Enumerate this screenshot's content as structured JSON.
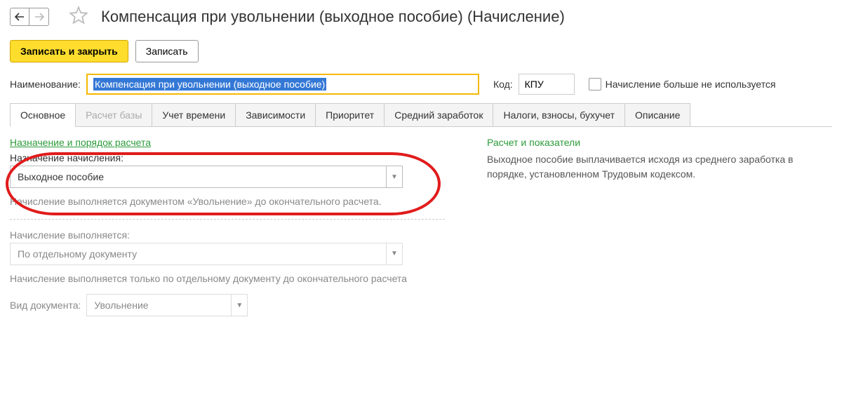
{
  "header": {
    "title": "Компенсация при увольнении (выходное пособие) (Начисление)"
  },
  "toolbar": {
    "save_close": "Записать и закрыть",
    "save": "Записать"
  },
  "form": {
    "name_label": "Наименование:",
    "name_value": "Компенсация при увольнении (выходное пособие)",
    "code_label": "Код:",
    "code_value": "КПУ",
    "not_used_label": "Начисление больше не используется"
  },
  "tabs": [
    {
      "label": "Основное",
      "active": true
    },
    {
      "label": "Расчет базы",
      "disabled": true
    },
    {
      "label": "Учет времени"
    },
    {
      "label": "Зависимости"
    },
    {
      "label": "Приоритет"
    },
    {
      "label": "Средний заработок"
    },
    {
      "label": "Налоги, взносы, бухучет"
    },
    {
      "label": "Описание"
    }
  ],
  "main": {
    "section1_title": "Назначение и порядок расчета",
    "purpose_label": "Назначение начисления:",
    "purpose_value": "Выходное пособие",
    "info1": "Начисление выполняется документом «Увольнение» до окончательного расчета.",
    "exec_label": "Начисление выполняется:",
    "exec_value": "По отдельному документу",
    "info2": "Начисление выполняется только по отдельному документу до окончательного расчета",
    "doc_type_label": "Вид документа:",
    "doc_type_value": "Увольнение"
  },
  "right": {
    "section_title": "Расчет и показатели",
    "desc": "Выходное пособие выплачивается исходя из среднего заработка в порядке, установленном Трудовым кодексом."
  }
}
